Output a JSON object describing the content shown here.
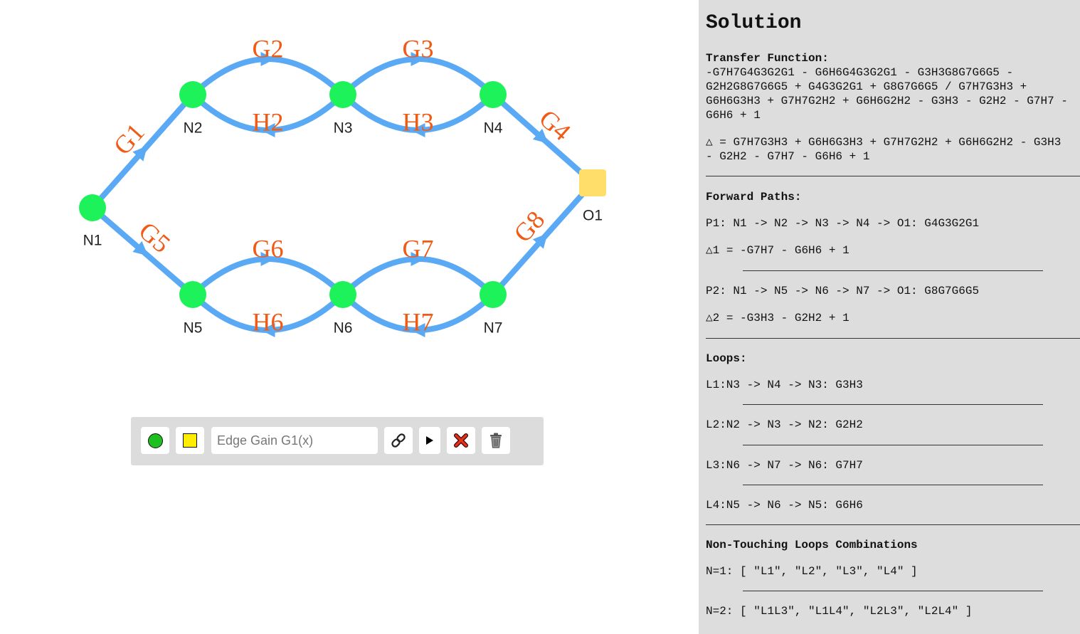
{
  "graph": {
    "nodes": [
      {
        "id": "N1",
        "label": "N1",
        "type": "node"
      },
      {
        "id": "N2",
        "label": "N2",
        "type": "node"
      },
      {
        "id": "N3",
        "label": "N3",
        "type": "node"
      },
      {
        "id": "N4",
        "label": "N4",
        "type": "node"
      },
      {
        "id": "O1",
        "label": "O1",
        "type": "output"
      },
      {
        "id": "N5",
        "label": "N5",
        "type": "node"
      },
      {
        "id": "N6",
        "label": "N6",
        "type": "node"
      },
      {
        "id": "N7",
        "label": "N7",
        "type": "node"
      }
    ],
    "edges": [
      {
        "from": "N1",
        "to": "N2",
        "gain": "G1"
      },
      {
        "from": "N2",
        "to": "N3",
        "gain": "G2"
      },
      {
        "from": "N3",
        "to": "N2",
        "gain": "H2"
      },
      {
        "from": "N3",
        "to": "N4",
        "gain": "G3"
      },
      {
        "from": "N4",
        "to": "N3",
        "gain": "H3"
      },
      {
        "from": "N4",
        "to": "O1",
        "gain": "G4"
      },
      {
        "from": "N1",
        "to": "N5",
        "gain": "G5"
      },
      {
        "from": "N5",
        "to": "N6",
        "gain": "G6"
      },
      {
        "from": "N6",
        "to": "N5",
        "gain": "H6"
      },
      {
        "from": "N6",
        "to": "N7",
        "gain": "G7"
      },
      {
        "from": "N7",
        "to": "N6",
        "gain": "H7"
      },
      {
        "from": "N7",
        "to": "O1",
        "gain": "G8"
      }
    ],
    "colors": {
      "edge": "#5aa9f5",
      "node": "#1ef25a",
      "output": "#ffde6a",
      "label": "#f05a14"
    }
  },
  "toolbar": {
    "gain_placeholder": "Edge Gain G1(x)",
    "icons": [
      "node-circle-icon",
      "output-square-icon",
      "link-icon",
      "play-icon",
      "clear-x-icon",
      "trash-icon"
    ]
  },
  "solution": {
    "title": "Solution",
    "transfer_function_label": "Transfer Function:",
    "transfer_function": "-G7H7G4G3G2G1 - G6H6G4G3G2G1 - G3H3G8G7G6G5 - G2H2G8G7G6G5 + G4G3G2G1 + G8G7G6G5 / G7H7G3H3 + G6H6G3H3 + G7H7G2H2 + G6H6G2H2 - G3H3 - G2H2 - G7H7 - G6H6 + 1",
    "delta": "△ = G7H7G3H3 + G6H6G3H3 + G7H7G2H2 + G6H6G2H2 - G3H3 - G2H2 - G7H7 - G6H6 + 1",
    "forward_paths_label": "Forward Paths:",
    "forward_paths": [
      {
        "path": "P1: N1 -> N2 -> N3 -> N4 -> O1: G4G3G2G1",
        "delta": "△1 = -G7H7 - G6H6 + 1"
      },
      {
        "path": "P2: N1 -> N5 -> N6 -> N7 -> O1: G8G7G6G5",
        "delta": "△2 = -G3H3 - G2H2 + 1"
      }
    ],
    "loops_label": "Loops:",
    "loops": [
      "L1:N3 -> N4 -> N3: G3H3",
      "L2:N2 -> N3 -> N2: G2H2",
      "L3:N6 -> N7 -> N6: G7H7",
      "L4:N5 -> N6 -> N5: G6H6"
    ],
    "non_touching_label": "Non-Touching Loops Combinations",
    "non_touching": [
      "N=1: [ \"L1\", \"L2\", \"L3\", \"L4\" ]",
      "N=2: [ \"L1L3\", \"L1L4\", \"L2L3\", \"L2L4\" ]"
    ]
  }
}
